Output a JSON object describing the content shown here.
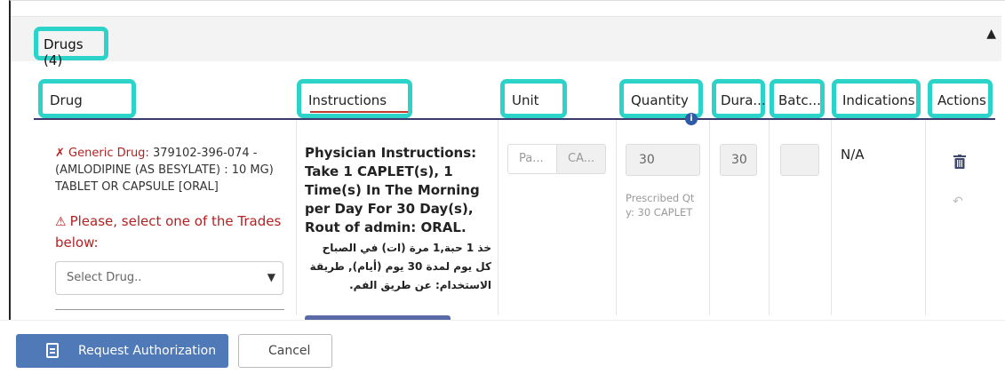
{
  "panel": {
    "title": "Drugs (4)"
  },
  "table": {
    "columns": [
      "Drug",
      "Instructions",
      "Unit",
      "Quantity",
      "Dura...",
      "Batc...",
      "Indications",
      "Actions"
    ]
  },
  "row": {
    "drug": {
      "generic_label": "Generic Drug:",
      "generic_text": " 379102-396-074 - (AMLODIPINE (AS BESYLATE) : 10 MG) TABLET OR CAPSULE [ORAL]",
      "warning": "Please, select one of the Trades below:",
      "select_placeholder": "Select Drug.."
    },
    "instructions": {
      "english": "Physician Instructions: Take 1 CAPLET(s), 1 Time(s) In The Morning per Day For 30 Day(s), Rout of admin: ORAL.",
      "arabic": "خذ 1 حبة,1 مرة (ات) في الصباح كل يوم لمدة 30 يوم (أيام), طريقة الاستخدام: عن طريق الفم."
    },
    "unit": {
      "left_placeholder": "Pa...",
      "right_placeholder": "CA..."
    },
    "quantity": {
      "value": "30",
      "note": "Prescribed Qty: 30 CAPLET"
    },
    "duration": {
      "value": "30"
    },
    "batch": {
      "value": ""
    },
    "indications": "N/A"
  },
  "footer": {
    "request_label": "Request Authorization",
    "cancel_label": "Cancel"
  },
  "colors": {
    "highlight": "#2bd3c9",
    "warning": "#b22222",
    "primary": "#5079b8"
  }
}
